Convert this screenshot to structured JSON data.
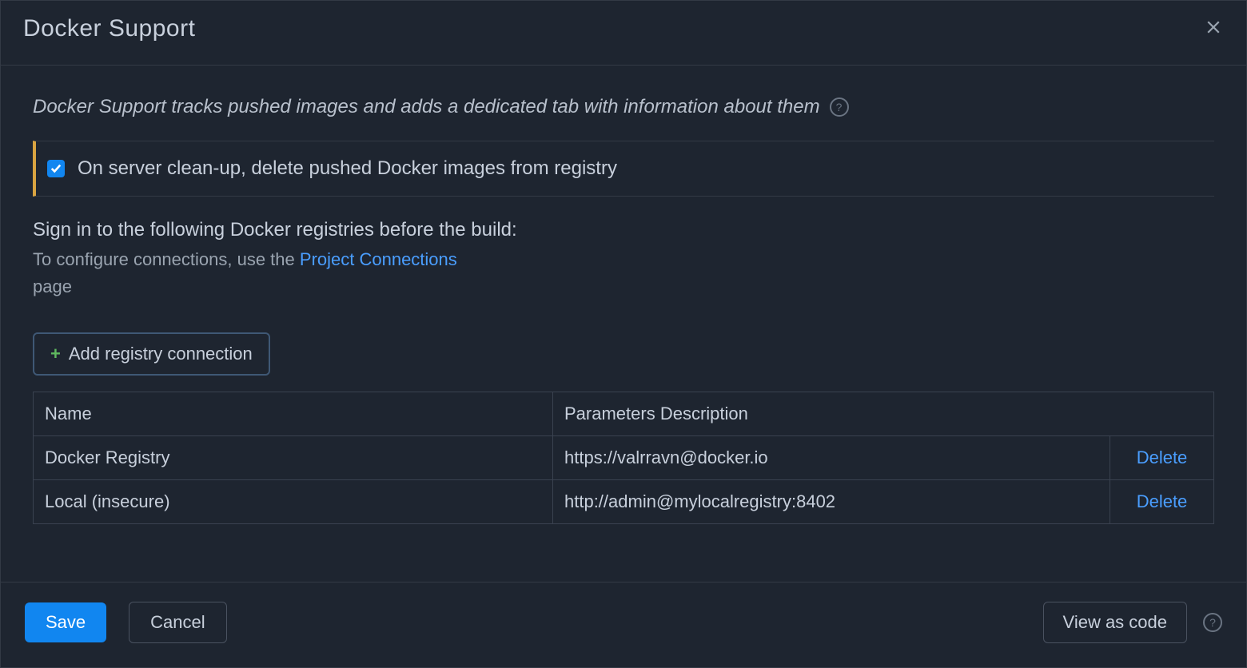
{
  "dialog": {
    "title": "Docker Support",
    "description": "Docker Support tracks pushed images and adds a dedicated tab with information about them",
    "cleanup_label": "On server clean-up, delete pushed Docker images from registry",
    "signin_heading": "Sign in to the following Docker registries before the build:",
    "signin_sub_prefix": "To configure connections, use the ",
    "signin_sub_link": "Project Connections",
    "signin_page": "page",
    "add_registry_label": "Add registry connection"
  },
  "table": {
    "headers": {
      "name": "Name",
      "params": "Parameters Description"
    },
    "rows": [
      {
        "name": "Docker Registry",
        "params": "https://valrravn@docker.io",
        "delete": "Delete"
      },
      {
        "name": "Local (insecure)",
        "params": "http://admin@mylocalregistry:8402",
        "delete": "Delete"
      }
    ]
  },
  "footer": {
    "save": "Save",
    "cancel": "Cancel",
    "view_as_code": "View as code"
  }
}
